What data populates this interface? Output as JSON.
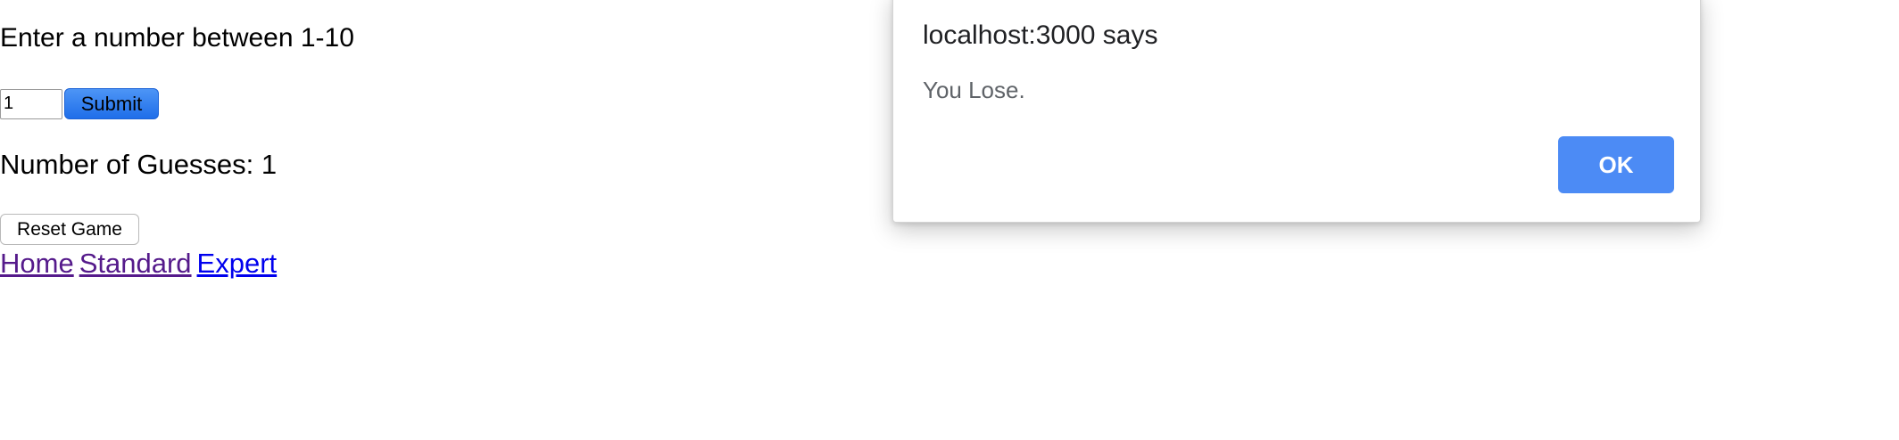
{
  "game": {
    "prompt": "Enter a number between 1-10",
    "guess_value": "1",
    "submit_label": "Submit",
    "guesses_text": "Number of Guesses: 1",
    "reset_label": "Reset Game"
  },
  "nav": {
    "links": [
      {
        "label": "Home",
        "state": "visited"
      },
      {
        "label": "Standard",
        "state": "visited"
      },
      {
        "label": "Expert",
        "state": "unvisited"
      }
    ]
  },
  "alert": {
    "title": "localhost:3000 says",
    "message": "You Lose.",
    "ok_label": "OK"
  },
  "colors": {
    "link_visited": "#551a8b",
    "link_unvisited": "#0000ee",
    "ok_button": "#4c8bf5",
    "submit_button": "#1f6ee9"
  }
}
